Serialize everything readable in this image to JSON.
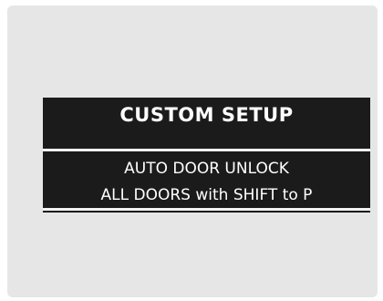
{
  "display": {
    "title": "CUSTOM SETUP",
    "setting_name": "AUTO DOOR UNLOCK",
    "setting_value": "ALL DOORS with SHIFT to P"
  },
  "colors": {
    "panel_background": "#e6e6e6",
    "screen_background": "#1b1b1b",
    "text": "#ffffff"
  }
}
